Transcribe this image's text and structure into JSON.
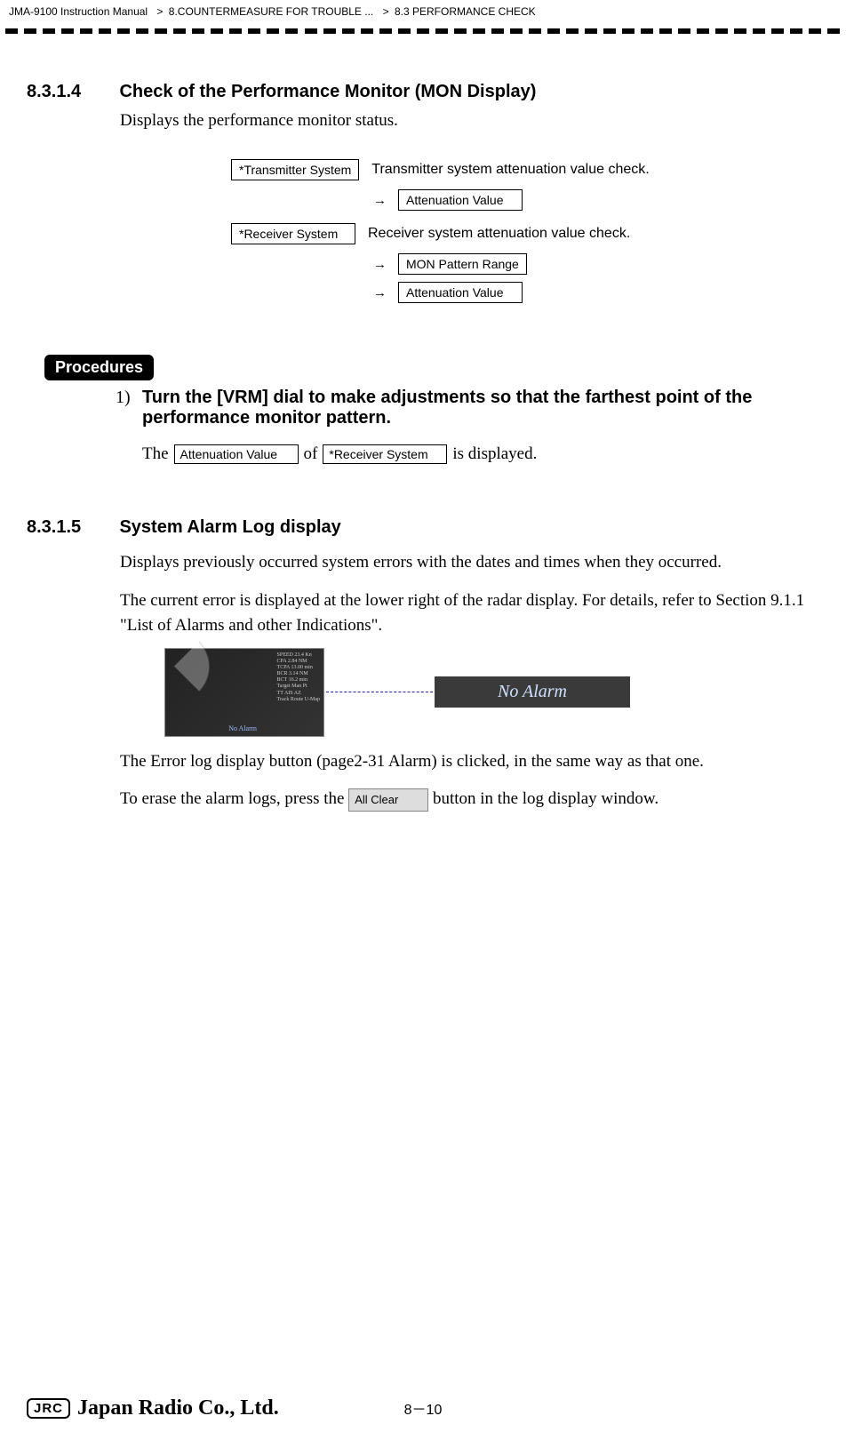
{
  "header": {
    "manual": "JMA-9100 Instruction Manual",
    "crumb1": "8.COUNTERMEASURE FOR TROUBLE ...",
    "crumb2": "8.3  PERFORMANCE CHECK"
  },
  "section1": {
    "num": "8.3.1.4",
    "title": "Check of the Performance Monitor  (MON Display)",
    "intro": "Displays the performance monitor status."
  },
  "mon": {
    "tx": "*Transmitter System",
    "tx_desc": "Transmitter system attenuation value check.",
    "atten": "Attenuation Value",
    "rx": "*Receiver System",
    "rx_desc": "Receiver system attenuation value check.",
    "pattern": "MON Pattern Range",
    "atten2": "Attenuation Value",
    "arrow": "→"
  },
  "procedures": {
    "label": "Procedures",
    "step_num": "1)",
    "step_text": "Turn the [VRM] dial to make adjustments so that the farthest point of the performance monitor pattern.",
    "line2_the": "The",
    "line2_box1": "Attenuation Value",
    "line2_of": "of",
    "line2_box2": "*Receiver System",
    "line2_end": "is displayed."
  },
  "section2": {
    "num": "8.3.1.5",
    "title": "System Alarm Log display",
    "p1": "Displays previously occurred system errors with the dates and times when they occurred.",
    "p2": "The current error is displayed at the lower right of the radar display. For details, refer to Section 9.1.1 \"List of Alarms and other Indications\".",
    "no_alarm": "No  Alarm",
    "p3": "The Error log display button (page2-31 Alarm) is clicked, in the same way as that one.",
    "p4a": "To erase the alarm logs, press the ",
    "all_clear": "All Clear",
    "p4b": " button in the log display window."
  },
  "footer": {
    "jrc": "JRC",
    "company": "Japan Radio Co., Ltd.",
    "page": "8－10"
  }
}
